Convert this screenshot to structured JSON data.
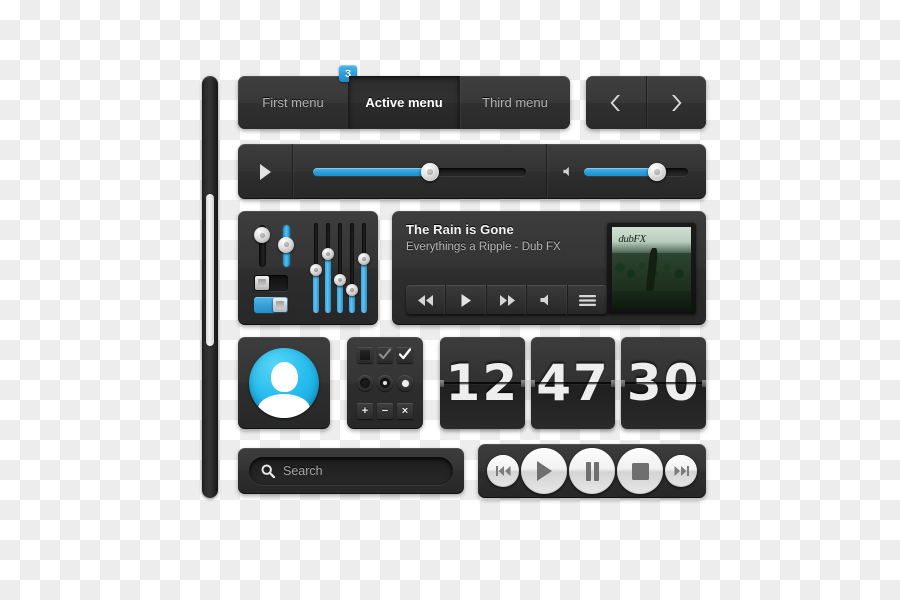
{
  "menu": {
    "tabs": [
      {
        "label": "First menu",
        "active": false,
        "badge": "3"
      },
      {
        "label": "Active menu",
        "active": true,
        "badge": null
      },
      {
        "label": "Third menu",
        "active": false,
        "badge": null
      }
    ],
    "nav": {
      "prev_icon": "chevron-left-icon",
      "next_icon": "chevron-right-icon"
    },
    "accent_color": "#2a9fdd",
    "active_text_color": "#ffffff",
    "inactive_text_color": "#b3b3b3"
  },
  "player_bar": {
    "play_icon": "play-icon",
    "volume_icon": "volume-icon",
    "progress_percent": 55,
    "volume_percent": 70
  },
  "equalizer": {
    "mini_sliders": [
      {
        "name": "mini-slider-1",
        "on": false,
        "knob_percent": 8
      },
      {
        "name": "mini-slider-2",
        "on": true,
        "knob_percent": 45
      }
    ],
    "toggles": [
      {
        "name": "toggle-off",
        "on": false
      },
      {
        "name": "toggle-on",
        "on": true
      }
    ],
    "band_values": [
      48,
      68,
      35,
      22,
      62
    ]
  },
  "now_playing": {
    "title": "The Rain is Gone",
    "artist": "Everythings a Ripple - Dub FX",
    "album_label": "dubFX",
    "controls": [
      {
        "name": "rewind-button",
        "icon": "rewind-icon"
      },
      {
        "name": "play-button",
        "icon": "play-icon"
      },
      {
        "name": "forward-button",
        "icon": "fast-forward-icon"
      },
      {
        "name": "volume-button",
        "icon": "volume-icon"
      },
      {
        "name": "menu-button",
        "icon": "hamburger-menu-icon"
      }
    ]
  },
  "avatar": {
    "icon": "user-avatar-icon",
    "circle_color": "#29bdef"
  },
  "form_controls": {
    "checkboxes": [
      {
        "name": "checkbox-unchecked",
        "state": "unchecked"
      },
      {
        "name": "checkbox-checked-dim",
        "state": "checked-dim"
      },
      {
        "name": "checkbox-checked",
        "state": "checked"
      }
    ],
    "radios": [
      {
        "name": "radio-empty",
        "state": "empty"
      },
      {
        "name": "radio-small-dot",
        "state": "small-dot"
      },
      {
        "name": "radio-selected",
        "state": "selected"
      }
    ],
    "buttons": [
      {
        "name": "add-button",
        "label": "+"
      },
      {
        "name": "remove-button",
        "label": "−"
      },
      {
        "name": "close-button",
        "label": "×"
      }
    ]
  },
  "clock": {
    "hours": "12",
    "minutes": "47",
    "seconds": "30"
  },
  "search": {
    "icon": "search-icon",
    "placeholder": "Search",
    "value": ""
  },
  "transport": {
    "buttons": [
      {
        "name": "previous-track-button",
        "icon": "skip-back-icon",
        "size": "sm"
      },
      {
        "name": "play-button",
        "icon": "play-icon",
        "size": "lg"
      },
      {
        "name": "pause-button",
        "icon": "pause-icon",
        "size": "lg"
      },
      {
        "name": "stop-button",
        "icon": "stop-icon",
        "size": "lg"
      },
      {
        "name": "next-track-button",
        "icon": "skip-forward-icon",
        "size": "sm"
      }
    ]
  },
  "scrollbar": {
    "name": "vertical-scrollbar",
    "thumb_top_percent": 28,
    "thumb_height_percent": 36
  }
}
